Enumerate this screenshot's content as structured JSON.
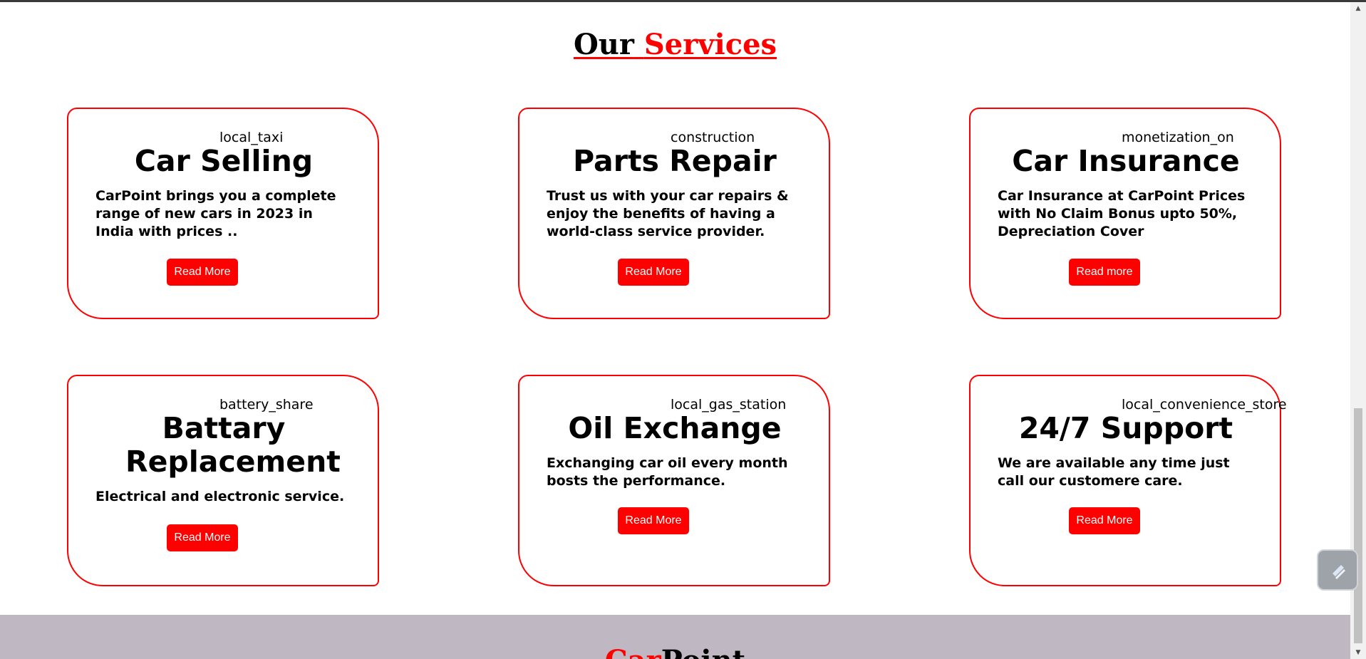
{
  "section": {
    "heading_word1": "Our",
    "heading_word2": "Services"
  },
  "cards": [
    {
      "icon": "local_taxi",
      "title": "Car Selling",
      "description": "CarPoint brings you a complete range of new cars in 2023 in India with prices ..",
      "button": "Read More"
    },
    {
      "icon": "construction",
      "title": "Parts Repair",
      "description": "Trust us with your car repairs & enjoy the benefits of having a world-class service provider.",
      "button": "Read More"
    },
    {
      "icon": "monetization_on",
      "title": "Car Insurance",
      "description": "Car Insurance at CarPoint Prices with No Claim Bonus upto 50%, Depreciation Cover",
      "button": "Read more"
    },
    {
      "icon": "battery_share",
      "title": "Battary Replacement",
      "description": "Electrical and electronic service.",
      "button": "Read More"
    },
    {
      "icon": "local_gas_station",
      "title": "Oil Exchange",
      "description": "Exchanging car oil every month bosts the performance.",
      "button": "Read More"
    },
    {
      "icon": "local_convenience_store",
      "title": "24/7 Support",
      "description": "We are available any time just call our customere care.",
      "button": "Read More"
    }
  ],
  "footer": {
    "brand_part1": "Car",
    "brand_part2": "Point"
  },
  "colors": {
    "accent": "#ff0000",
    "footer_bg": "#bfb8c3"
  }
}
